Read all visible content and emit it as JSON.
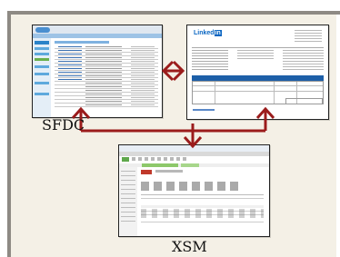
{
  "labels": {
    "sfdc": "SFDC",
    "xsm": "XSM"
  },
  "screens": {
    "sfdc": {
      "icon": "salesforce-screenshot"
    },
    "linkedin": {
      "icon": "linkedin-screenshot",
      "brand_text": "Linked",
      "brand_suffix": "in"
    },
    "xsm": {
      "icon": "xsm-screenshot"
    }
  },
  "colors": {
    "arrow": "#9b1c1c",
    "background": "#f4f0e6",
    "frame_line": "#8e8a84"
  }
}
